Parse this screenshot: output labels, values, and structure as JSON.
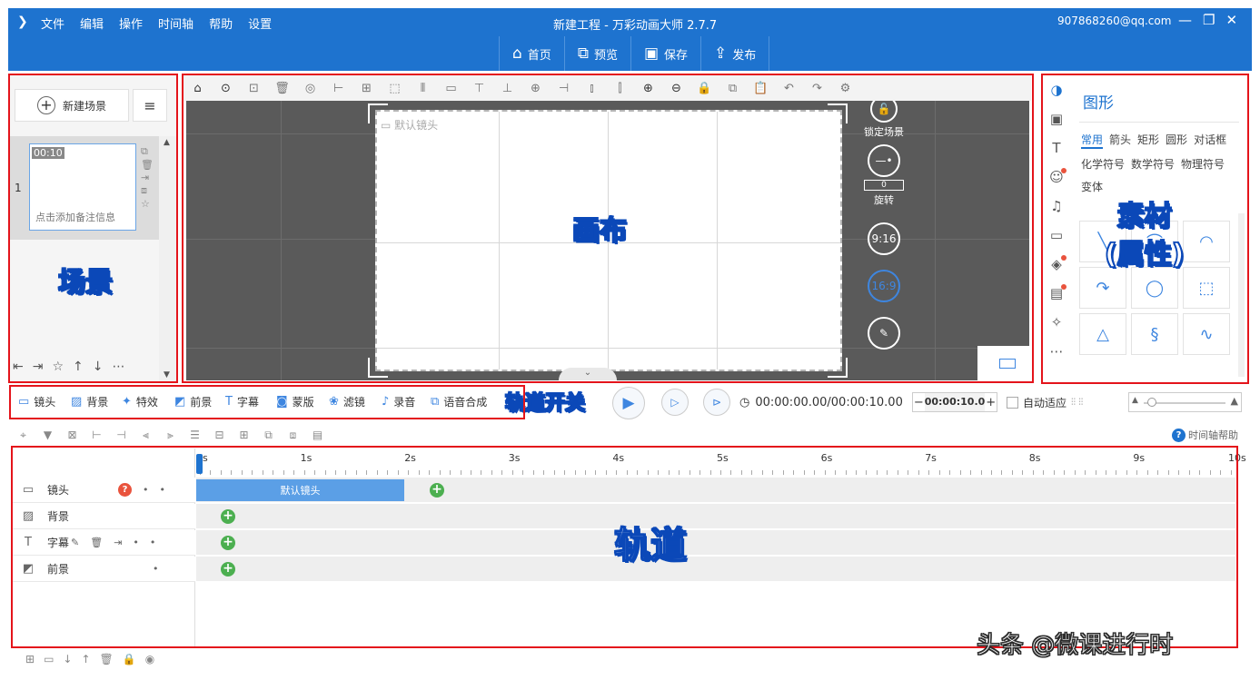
{
  "titlebar": {
    "menu": [
      "文件",
      "编辑",
      "操作",
      "时间轴",
      "帮助",
      "设置"
    ],
    "title": "新建工程 - 万彩动画大师 2.7.7",
    "account": "907868260@qq.com",
    "minimize": "—",
    "restore": "❐",
    "close": "✕"
  },
  "navbar": {
    "items": [
      {
        "label": "首页",
        "icon": "home-icon",
        "glyph": "⌂"
      },
      {
        "label": "预览",
        "icon": "preview-icon",
        "glyph": "⧉"
      },
      {
        "label": "保存",
        "icon": "save-icon",
        "glyph": "▣"
      },
      {
        "label": "发布",
        "icon": "publish-icon",
        "glyph": "⇪"
      }
    ]
  },
  "scene_panel": {
    "new_scene": "新建场景",
    "scene_number": "1",
    "scene_time": "00:10",
    "scene_note": "点击添加备注信息",
    "annotation": "场景"
  },
  "canvas": {
    "default_camera": "默认镜头",
    "lock_scene": "锁定场景",
    "rotate_value": "0",
    "rotate_label": "旋转",
    "ratio_916": "9:16",
    "ratio_169": "16:9",
    "annotation": "画布"
  },
  "right_panel": {
    "title": "图形",
    "categories": [
      "常用",
      "箭头",
      "矩形",
      "圆形",
      "对话框",
      "化学符号",
      "数学符号",
      "物理符号",
      "变体"
    ],
    "active_category": "常用",
    "annotation_line1": "素材",
    "annotation_line2": "(属性)"
  },
  "trackbar": {
    "switches": [
      {
        "label": "镜头",
        "icon": "camera-icon",
        "glyph": "▭"
      },
      {
        "label": "背景",
        "icon": "background-icon",
        "glyph": "▨"
      },
      {
        "label": "特效",
        "icon": "effects-icon",
        "glyph": "✦"
      },
      {
        "label": "前景",
        "icon": "foreground-icon",
        "glyph": "◩"
      },
      {
        "label": "字幕",
        "icon": "subtitle-icon",
        "glyph": "T"
      },
      {
        "label": "蒙版",
        "icon": "mask-icon",
        "glyph": "◙"
      },
      {
        "label": "滤镜",
        "icon": "filter-icon",
        "glyph": "❀"
      },
      {
        "label": "录音",
        "icon": "mic-icon",
        "glyph": "♪"
      },
      {
        "label": "语音合成",
        "icon": "tts-icon",
        "glyph": "⧉"
      }
    ],
    "annotation": "轨道开关",
    "time_display": "00:00:00.00/00:00:10.00",
    "duration_value": "00:00:10.0",
    "auto_fit": "自动适应"
  },
  "timeline": {
    "help": "时间轴帮助",
    "ticks": [
      "0s",
      "1s",
      "2s",
      "3s",
      "4s",
      "5s",
      "6s",
      "7s",
      "8s",
      "9s",
      "10s"
    ],
    "tracks": [
      {
        "name": "镜头",
        "icon": "camera-icon"
      },
      {
        "name": "背景",
        "icon": "background-icon"
      },
      {
        "name": "字幕",
        "icon": "subtitle-icon"
      },
      {
        "name": "前景",
        "icon": "foreground-icon"
      }
    ],
    "camera_clip": "默认镜头",
    "annotation": "轨道"
  },
  "watermark": "头条 @微课进行时"
}
